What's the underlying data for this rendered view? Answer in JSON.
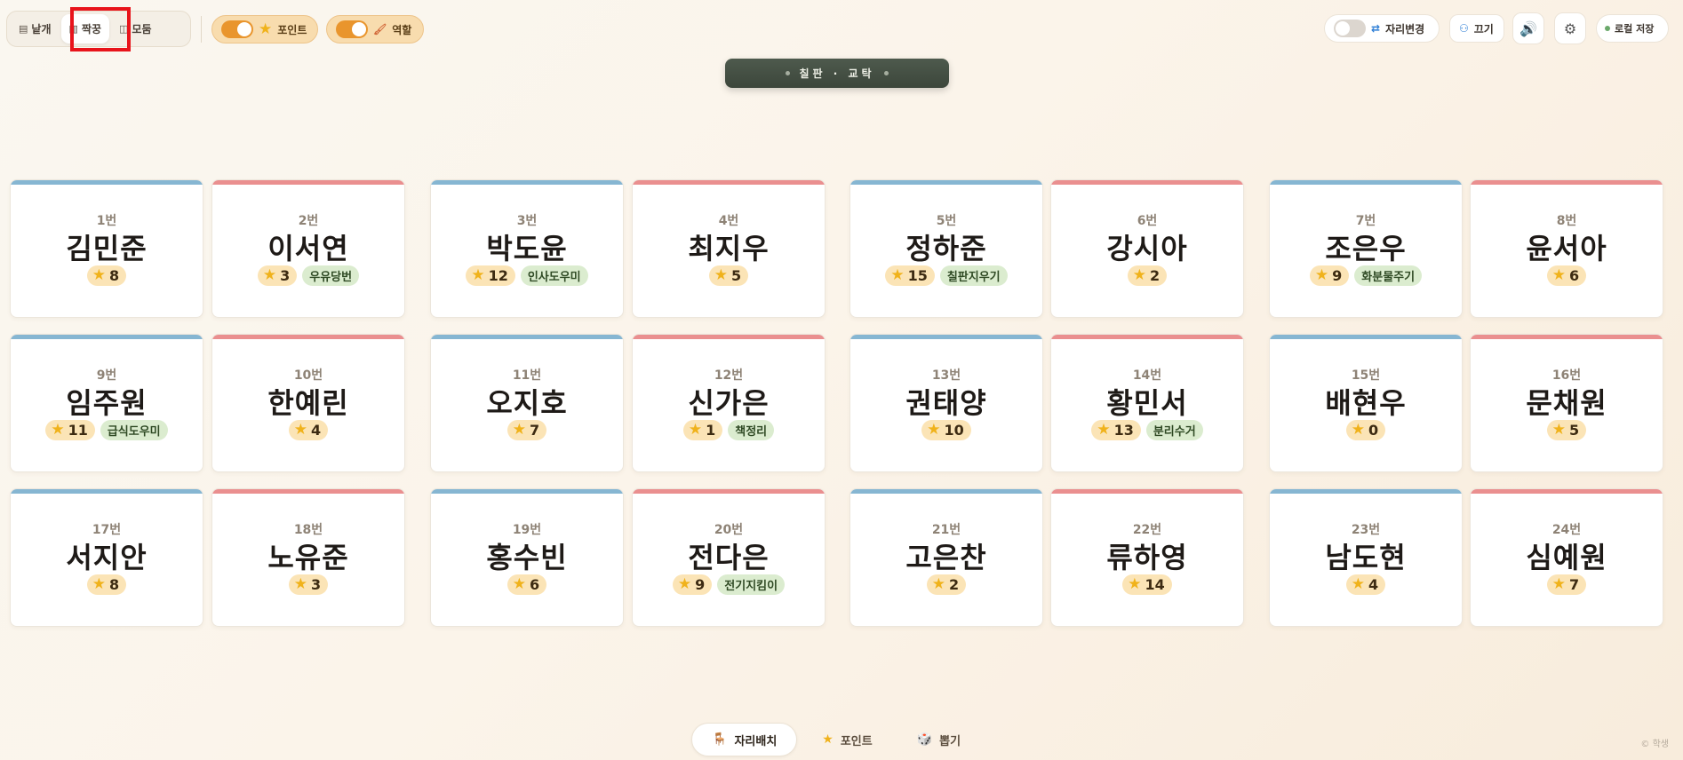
{
  "toolbar": {
    "layout_buttons": [
      {
        "id": "single",
        "icon": "▤",
        "label": "낱개"
      },
      {
        "id": "pair",
        "icon": "▥",
        "label": "짝꿍"
      },
      {
        "id": "group",
        "icon": "◫",
        "label": "모둠"
      }
    ],
    "active_layout": "pair",
    "points_toggle": {
      "label": "포인트",
      "on": true
    },
    "roles_toggle": {
      "label": "역할",
      "on": true
    },
    "seat_change": {
      "label": "자리변경",
      "on": false
    },
    "pull_label": "끄기",
    "save_label": "로컬 저장"
  },
  "board": {
    "text": "칠판 · 교탁"
  },
  "seats": [
    {
      "num": "1번",
      "name": "김민준",
      "points": "8",
      "role": "",
      "gender": "boy"
    },
    {
      "num": "2번",
      "name": "이서연",
      "points": "3",
      "role": "우유당번",
      "gender": "girl"
    },
    {
      "num": "3번",
      "name": "박도윤",
      "points": "12",
      "role": "인사도우미",
      "gender": "boy"
    },
    {
      "num": "4번",
      "name": "최지우",
      "points": "5",
      "role": "",
      "gender": "girl"
    },
    {
      "num": "5번",
      "name": "정하준",
      "points": "15",
      "role": "칠판지우기",
      "gender": "boy"
    },
    {
      "num": "6번",
      "name": "강시아",
      "points": "2",
      "role": "",
      "gender": "girl"
    },
    {
      "num": "7번",
      "name": "조은우",
      "points": "9",
      "role": "화분물주기",
      "gender": "boy"
    },
    {
      "num": "8번",
      "name": "윤서아",
      "points": "6",
      "role": "",
      "gender": "girl"
    },
    {
      "num": "9번",
      "name": "임주원",
      "points": "11",
      "role": "급식도우미",
      "gender": "boy"
    },
    {
      "num": "10번",
      "name": "한예린",
      "points": "4",
      "role": "",
      "gender": "girl"
    },
    {
      "num": "11번",
      "name": "오지호",
      "points": "7",
      "role": "",
      "gender": "boy"
    },
    {
      "num": "12번",
      "name": "신가은",
      "points": "1",
      "role": "책정리",
      "gender": "girl"
    },
    {
      "num": "13번",
      "name": "권태양",
      "points": "10",
      "role": "",
      "gender": "boy"
    },
    {
      "num": "14번",
      "name": "황민서",
      "points": "13",
      "role": "분리수거",
      "gender": "girl"
    },
    {
      "num": "15번",
      "name": "배현우",
      "points": "0",
      "role": "",
      "gender": "boy"
    },
    {
      "num": "16번",
      "name": "문채원",
      "points": "5",
      "role": "",
      "gender": "girl"
    },
    {
      "num": "17번",
      "name": "서지안",
      "points": "8",
      "role": "",
      "gender": "boy"
    },
    {
      "num": "18번",
      "name": "노유준",
      "points": "3",
      "role": "",
      "gender": "girl"
    },
    {
      "num": "19번",
      "name": "홍수빈",
      "points": "6",
      "role": "",
      "gender": "boy"
    },
    {
      "num": "20번",
      "name": "전다은",
      "points": "9",
      "role": "전기지킴이",
      "gender": "girl"
    },
    {
      "num": "21번",
      "name": "고은찬",
      "points": "2",
      "role": "",
      "gender": "boy"
    },
    {
      "num": "22번",
      "name": "류하영",
      "points": "14",
      "role": "",
      "gender": "girl"
    },
    {
      "num": "23번",
      "name": "남도현",
      "points": "4",
      "role": "",
      "gender": "boy"
    },
    {
      "num": "24번",
      "name": "심예원",
      "points": "7",
      "role": "",
      "gender": "girl"
    }
  ],
  "bottom_nav": [
    {
      "icon": "chair-icon",
      "glyph": "🪑",
      "label": "자리배치",
      "active": true
    },
    {
      "icon": "star-icon",
      "glyph": "★",
      "label": "포인트",
      "active": false
    },
    {
      "icon": "dice-icon",
      "glyph": "🎲",
      "label": "뽑기",
      "active": false
    }
  ],
  "copyright": "© 학생"
}
